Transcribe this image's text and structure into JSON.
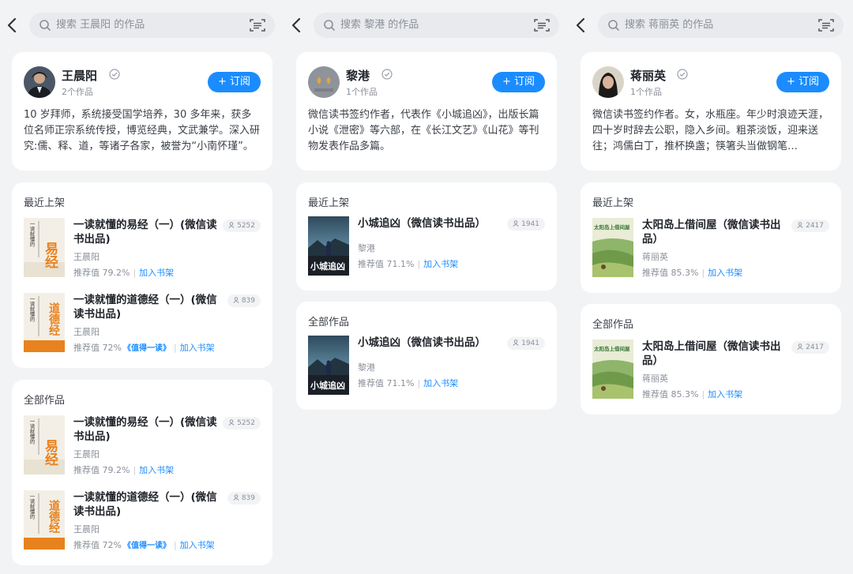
{
  "panels": [
    {
      "search_placeholder": "搜索 王晨阳 的作品",
      "author": {
        "name": "王晨阳",
        "works_count": "2个作品",
        "subscribe_label": "+ 订阅",
        "bio": "10 岁拜师，系统接受国学培养，30 多年来，获多位名师正宗系统传授，博览经典，文武兼学。深入研究:儒、释、道，等诸子各家，被誉为“小南怀瑾”。"
      },
      "recent": {
        "title": "最近上架",
        "books": [
          {
            "title": "一读就懂的易经（一）(微信读书出品)",
            "author": "王晨阳",
            "readers": "5252",
            "rating": "推荐值 79.2%",
            "badge": "",
            "add_label": "加入书架"
          },
          {
            "title": "一读就懂的道德经（一）(微信读书出品)",
            "author": "王晨阳",
            "readers": "839",
            "rating": "推荐值 72%",
            "badge": "值得一读",
            "add_label": "加入书架"
          }
        ]
      },
      "all": {
        "title": "全部作品",
        "books": [
          {
            "title": "一读就懂的易经（一）(微信读书出品)",
            "author": "王晨阳",
            "readers": "5252",
            "rating": "推荐值 79.2%",
            "badge": "",
            "add_label": "加入书架"
          },
          {
            "title": "一读就懂的道德经（一）(微信读书出品)",
            "author": "王晨阳",
            "readers": "839",
            "rating": "推荐值 72%",
            "badge": "值得一读",
            "add_label": "加入书架"
          }
        ]
      }
    },
    {
      "search_placeholder": "搜索 黎港 的作品",
      "author": {
        "name": "黎港",
        "works_count": "1个作品",
        "subscribe_label": "+ 订阅",
        "bio": "微信读书签约作者，代表作《小城追凶》，出版长篇小说《泄密》等六部，在《长江文艺》《山花》等刊物发表作品多篇。"
      },
      "recent": {
        "title": "最近上架",
        "books": [
          {
            "title": "小城追凶（微信读书出品）",
            "author": "黎港",
            "readers": "1941",
            "rating": "推荐值 71.1%",
            "badge": "",
            "add_label": "加入书架"
          }
        ]
      },
      "all": {
        "title": "全部作品",
        "books": [
          {
            "title": "小城追凶（微信读书出品）",
            "author": "黎港",
            "readers": "1941",
            "rating": "推荐值 71.1%",
            "badge": "",
            "add_label": "加入书架"
          }
        ]
      }
    },
    {
      "search_placeholder": "搜索 蒋丽英 的作品",
      "author": {
        "name": "蒋丽英",
        "works_count": "1个作品",
        "subscribe_label": "+ 订阅",
        "bio": "微信读书签约作者。女，水瓶座。年少时浪迹天涯，四十岁时辞去公职，隐入乡间。粗茶淡饭，迎来送往；鸿儒白丁，推杯换盏；筷箸头当做钢笔…"
      },
      "recent": {
        "title": "最近上架",
        "books": [
          {
            "title": "太阳岛上借间屋（微信读书出品）",
            "author": "蒋丽英",
            "readers": "2417",
            "rating": "推荐值 85.3%",
            "badge": "",
            "add_label": "加入书架"
          }
        ]
      },
      "all": {
        "title": "全部作品",
        "books": [
          {
            "title": "太阳岛上借间屋（微信读书出品）",
            "author": "蒋丽英",
            "readers": "2417",
            "rating": "推荐值 85.3%",
            "badge": "",
            "add_label": "加入书架"
          }
        ]
      }
    }
  ],
  "covers": {
    "yijing": {
      "big": "易经",
      "side": "一读就懂的"
    },
    "daodejing": {
      "big": "道德经",
      "side": "一读就懂的"
    },
    "xiaocheng": {
      "big": "小城追凶"
    },
    "taiyangdao": {
      "big": "太阳岛上借间屋"
    }
  },
  "colors": {
    "accent": "#1a8cff",
    "background": "#f2f3f5",
    "card": "#ffffff",
    "cover_orange": "#e8821e"
  },
  "icons": [
    "back-icon",
    "search-icon",
    "scan-icon",
    "verified-icon",
    "reader-icon"
  ]
}
